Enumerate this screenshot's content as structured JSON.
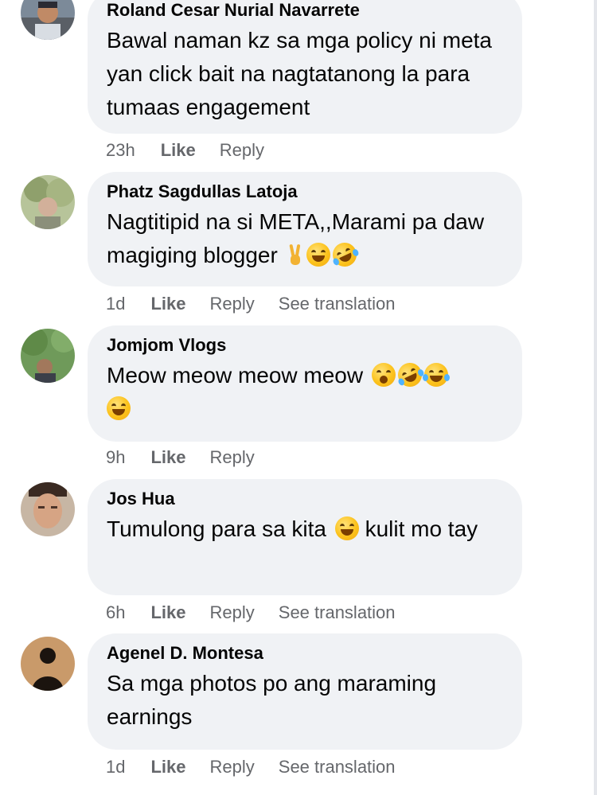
{
  "comments": [
    {
      "author": "Roland Cesar Nurial Navarrete",
      "text": "Bawal naman kz sa mga policy ni meta yan click bait na nagtatanong la para tumaas engagement",
      "time": "23h",
      "like_label": "Like",
      "reply_label": "Reply",
      "translation_label": "",
      "avatar_icon": "avatar-photo"
    },
    {
      "author": "Phatz Sagdullas Latoja",
      "text": "Nagtitipid na si META,,Marami pa daw magiging blogger",
      "emojis": [
        "victory-hand",
        "grinning-squinting-face",
        "rolling-on-floor-laughing-face"
      ],
      "time": "1d",
      "like_label": "Like",
      "reply_label": "Reply",
      "translation_label": "See translation",
      "avatar_icon": "avatar-photo"
    },
    {
      "author": "Jomjom Vlogs",
      "text": "Meow meow meow meow",
      "emojis": [
        "face-with-open-mouth",
        "rolling-on-floor-laughing-face",
        "tears-of-joy-face",
        "grinning-squinting-face"
      ],
      "time": "9h",
      "like_label": "Like",
      "reply_label": "Reply",
      "translation_label": "",
      "avatar_icon": "avatar-photo"
    },
    {
      "author": "Jos Hua",
      "text_before": "Tumulong para sa kita",
      "text_after": "kulit mo tay",
      "emojis": [
        "grinning-squinting-face"
      ],
      "time": "6h",
      "like_label": "Like",
      "reply_label": "Reply",
      "translation_label": "See translation",
      "avatar_icon": "avatar-photo"
    },
    {
      "author": "Agenel D. Montesa",
      "text": "Sa mga photos po ang maraming earnings",
      "time": "1d",
      "like_label": "Like",
      "reply_label": "Reply",
      "translation_label": "See translation",
      "avatar_icon": "avatar-photo"
    }
  ],
  "colors": {
    "bubble": "#f0f2f5",
    "meta_text": "#65676b",
    "text": "#050505"
  }
}
